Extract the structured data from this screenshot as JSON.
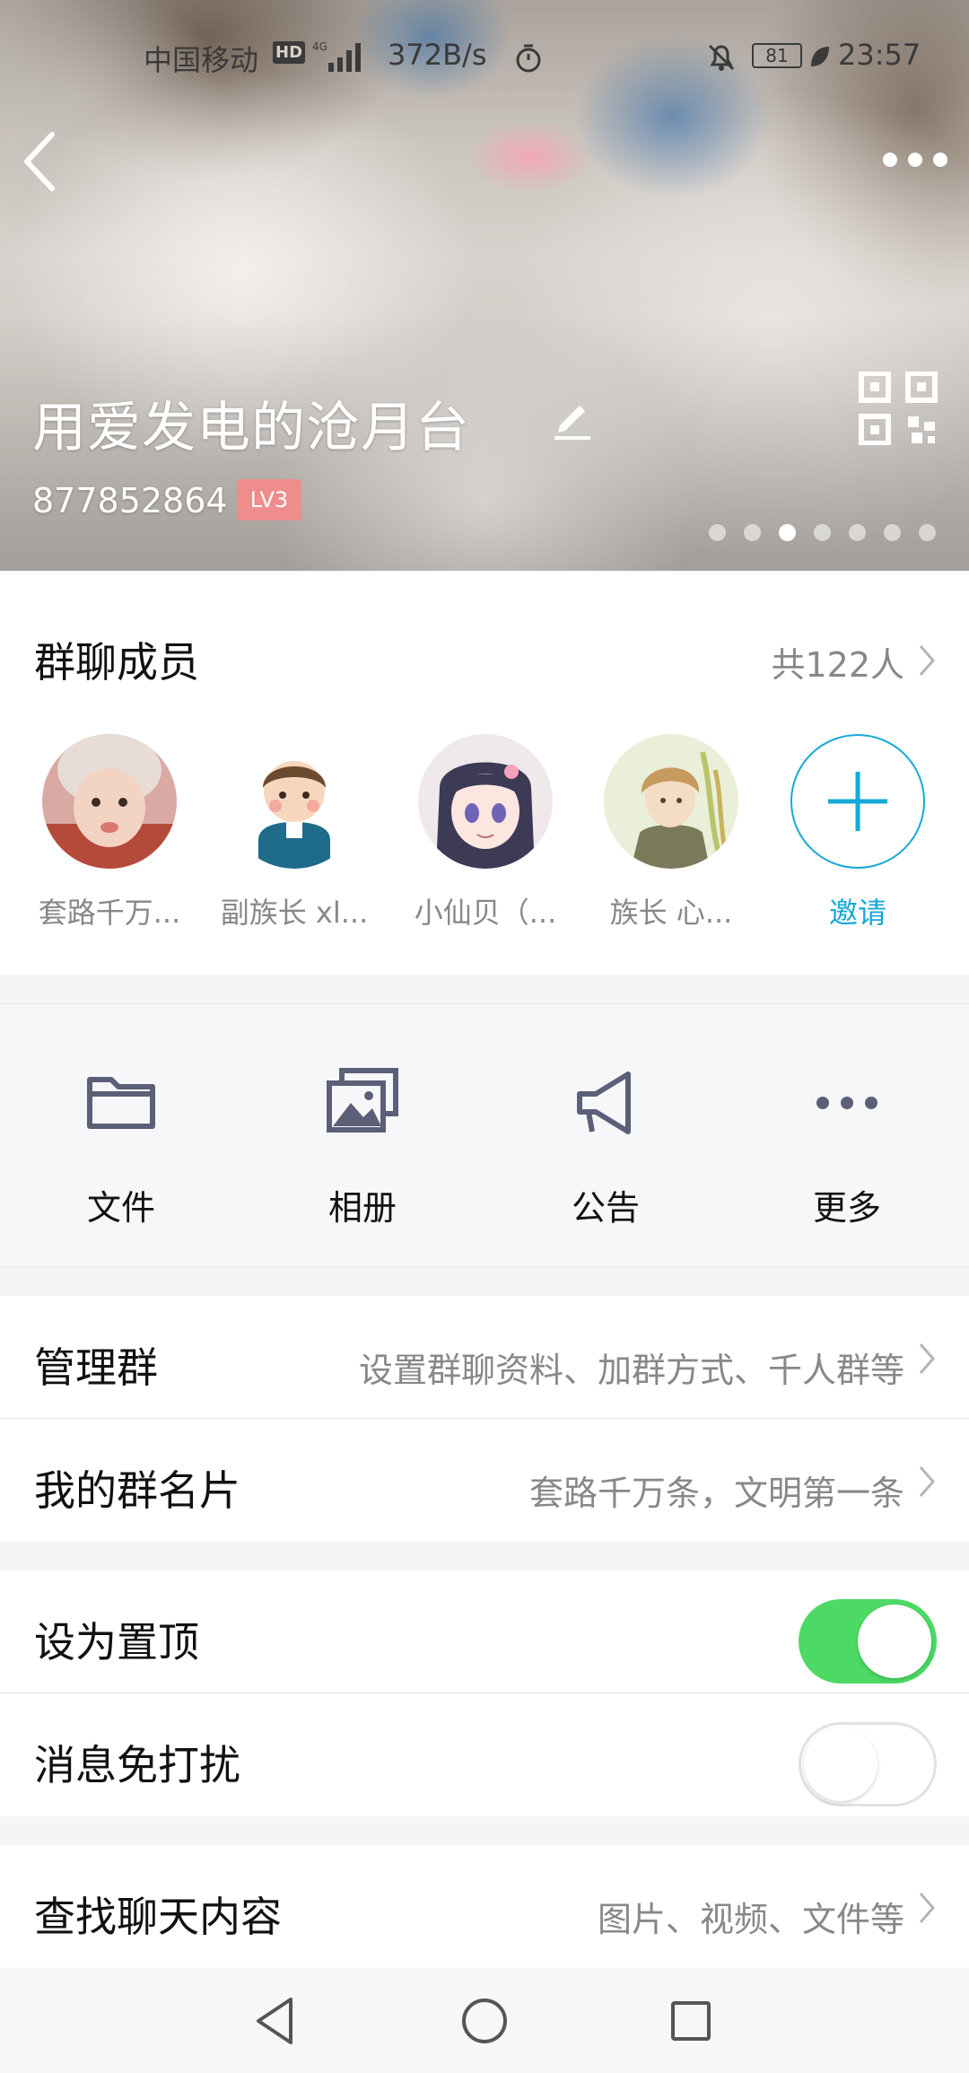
{
  "status_bar": {
    "carrier": "中国移动",
    "hd": "HD",
    "network_speed": "372B/s",
    "battery": "81",
    "time": "23:57"
  },
  "group": {
    "name": "用爱发电的沧月台",
    "id": "877852864",
    "level": "LV3",
    "banner_page_count": 7,
    "banner_active_index": 2
  },
  "members": {
    "title": "群聊成员",
    "count_text": "共122人",
    "items": [
      {
        "name": "套路千万..."
      },
      {
        "name": "副族长 xl..."
      },
      {
        "name": "小仙贝（..."
      },
      {
        "name": "族长 心..."
      }
    ],
    "invite_label": "邀请"
  },
  "actions": [
    {
      "label": "文件",
      "icon": "folder-icon"
    },
    {
      "label": "相册",
      "icon": "photo-album-icon"
    },
    {
      "label": "公告",
      "icon": "megaphone-icon"
    },
    {
      "label": "更多",
      "icon": "more-dots-icon"
    }
  ],
  "settings": {
    "manage": {
      "label": "管理群",
      "value": "设置群聊资料、加群方式、千人群等"
    },
    "my_card": {
      "label": "我的群名片",
      "value": "套路千万条，文明第一条"
    },
    "pin_top": {
      "label": "设为置顶",
      "enabled": true
    },
    "mute": {
      "label": "消息免打扰",
      "enabled": false
    },
    "search": {
      "label": "查找聊天内容",
      "value": "图片、视频、文件等"
    }
  },
  "colors": {
    "accent_blue": "#16a8d8",
    "toggle_on": "#4cd964",
    "level_badge": "#ef8c8c"
  }
}
